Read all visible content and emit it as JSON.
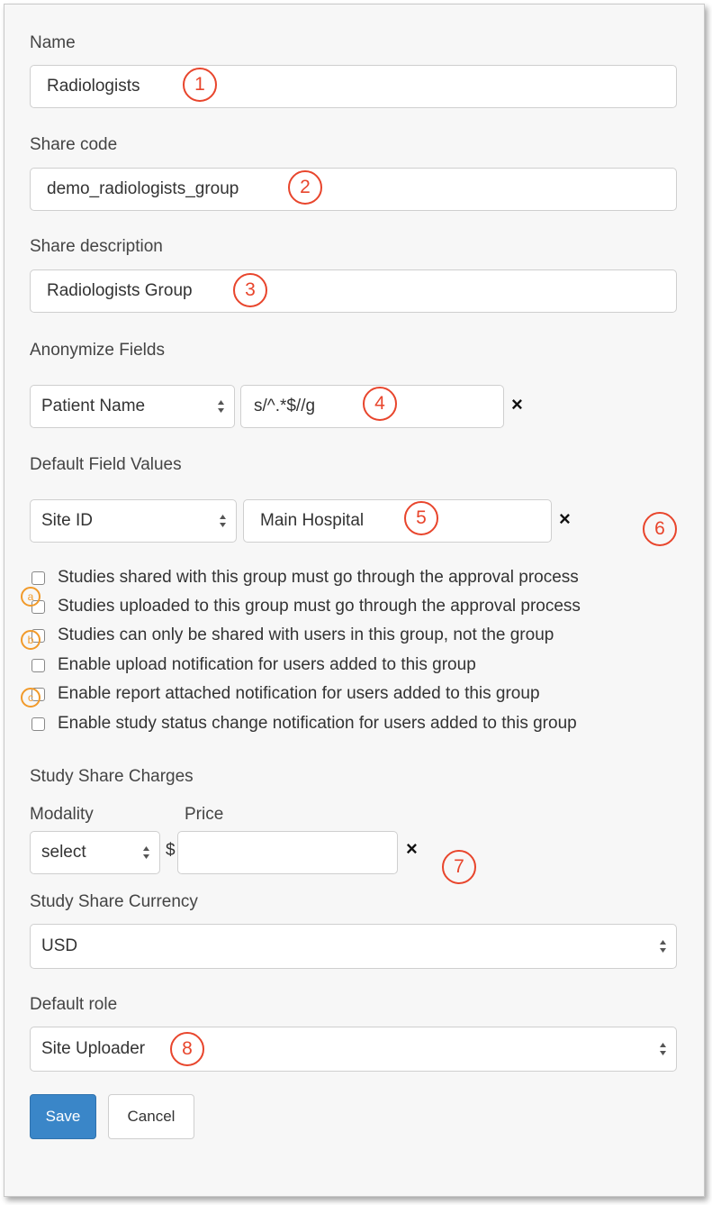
{
  "form": {
    "name": {
      "label": "Name",
      "value": "Radiologists"
    },
    "share_code": {
      "label": "Share code",
      "value": "demo_radiologists_group"
    },
    "share_description": {
      "label": "Share description",
      "value": "Radiologists Group"
    },
    "anonymize": {
      "label": "Anonymize Fields",
      "field": "Patient Name",
      "value": "s/^.*$//g",
      "remove": "×"
    },
    "default_values": {
      "label": "Default Field Values",
      "field": "Site ID",
      "value": "Main Hospital",
      "remove": "×"
    },
    "checkboxes": [
      {
        "label": "Studies shared with this group must go through the approval process",
        "checked": false
      },
      {
        "label": "Studies uploaded to this group must go through the approval process",
        "checked": false
      },
      {
        "label": "Studies can only be shared with users in this group, not the group",
        "checked": false
      },
      {
        "label": "Enable upload notification for users added to this group",
        "checked": false
      },
      {
        "label": "Enable report attached notification for users added to this group",
        "checked": false
      },
      {
        "label": "Enable study status change notification for users added to this group",
        "checked": false
      }
    ],
    "charges": {
      "label": "Study Share Charges",
      "modality_label": "Modality",
      "price_label": "Price",
      "modality_value": "select",
      "currency_symbol": "$",
      "price_value": "",
      "remove": "×"
    },
    "currency": {
      "label": "Study Share Currency",
      "value": "USD"
    },
    "role": {
      "label": "Default role",
      "value": "Site Uploader"
    },
    "buttons": {
      "save": "Save",
      "cancel": "Cancel"
    }
  },
  "callouts": [
    "1",
    "2",
    "3",
    "4",
    "5",
    "6",
    "7",
    "8"
  ],
  "mini_callouts": [
    "a",
    "b",
    "c"
  ],
  "colors": {
    "callout": "#e8452c",
    "mini_callout": "#f19a2a",
    "primary": "#3a86c8"
  }
}
